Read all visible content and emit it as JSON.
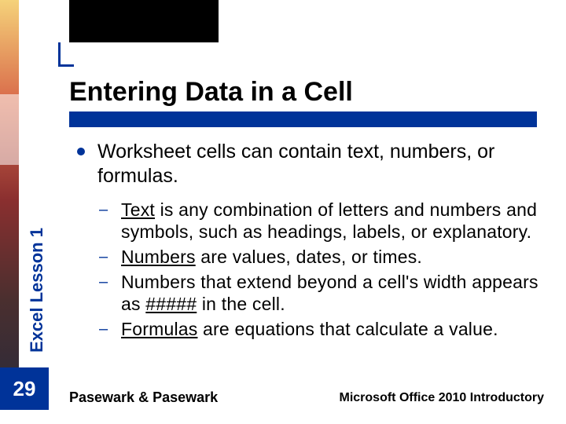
{
  "course_label": "Excel Lesson 1",
  "page_number": "29",
  "title": "Entering Data in a Cell",
  "main_bullet": "Worksheet cells can contain text, numbers, or formulas.",
  "sub_bullets": [
    {
      "ul": "Text",
      "rest": " is any combination of letters and numbers and symbols, such as headings, labels, or explanatory."
    },
    {
      "ul": "Numbers",
      "rest": " are values, dates, or times."
    },
    {
      "pre": "Numbers that extend beyond a cell's width appears as ",
      "ul": "#####",
      "rest": " in the cell."
    },
    {
      "ul": "Formulas",
      "rest": " are equations that calculate a value."
    }
  ],
  "footer_left": "Pasewark & Pasewark",
  "footer_right": "Microsoft Office 2010 Introductory"
}
